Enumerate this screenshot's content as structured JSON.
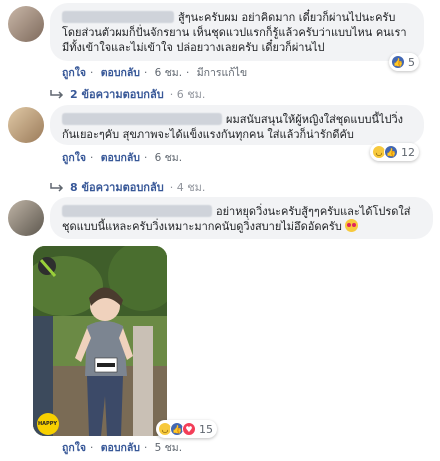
{
  "comments": [
    {
      "text": "สู้ๆนะครับผม อย่าคิดมาก เดี๋ยวก็ผ่านไปนะครับ โดยส่วนตัวผมก็ปั่นจักรยาน เห็นชุดแวปแรกก็รู้แล้วครับว่าแบบไหน คนเรามีทั้งเข้าใจและไม่เข้าใจ ปล่อยวางเลยครับ เดี๋ยวก็ผ่านไป",
      "like_label": "ถูกใจ",
      "reply_label": "ตอบกลับ",
      "time": "6 ชม.",
      "edited_label": "มีการแก้ไข",
      "reaction_count": "5",
      "replies_label": "2 ข้อความตอบกลับ",
      "replies_time": "6 ชม."
    },
    {
      "text": "ผมสนับสนุนให้ผู้หญิงใส่ชุดแบบนี้ไปวิ่งกันเยอะๆคับ สุขภาพจะได้แข็งแรงกันทุกคน ใส่แล้วก็น่ารักดีคับ",
      "like_label": "ถูกใจ",
      "reply_label": "ตอบกลับ",
      "time": "6 ชม.",
      "reaction_count": "12",
      "replies_label": "8 ข้อความตอบกลับ",
      "replies_time": "4 ชม."
    },
    {
      "text": "อย่าหยุดวิ่งนะครับสู้ๆๆครับและได้โปรดใส่ชุดแบบนี้แหละครับวิ่งเหมาะมากคนับดูวิ่งสบายไม่อึดอัดครับ",
      "like_label": "ถูกใจ",
      "reply_label": "ตอบกลับ",
      "time": "5 ชม.",
      "reaction_count": "15",
      "photo_badge": "HAPPY"
    }
  ],
  "colors": {
    "link": "#385898",
    "bubble": "#f2f3f5",
    "like": "#4267b2",
    "love": "#f33e58",
    "haha": "#f7c93d"
  },
  "icons": [
    "like-reaction-icon",
    "love-reaction-icon",
    "haha-reaction-icon",
    "reply-arrow-icon",
    "heart-eyes-emoji"
  ]
}
